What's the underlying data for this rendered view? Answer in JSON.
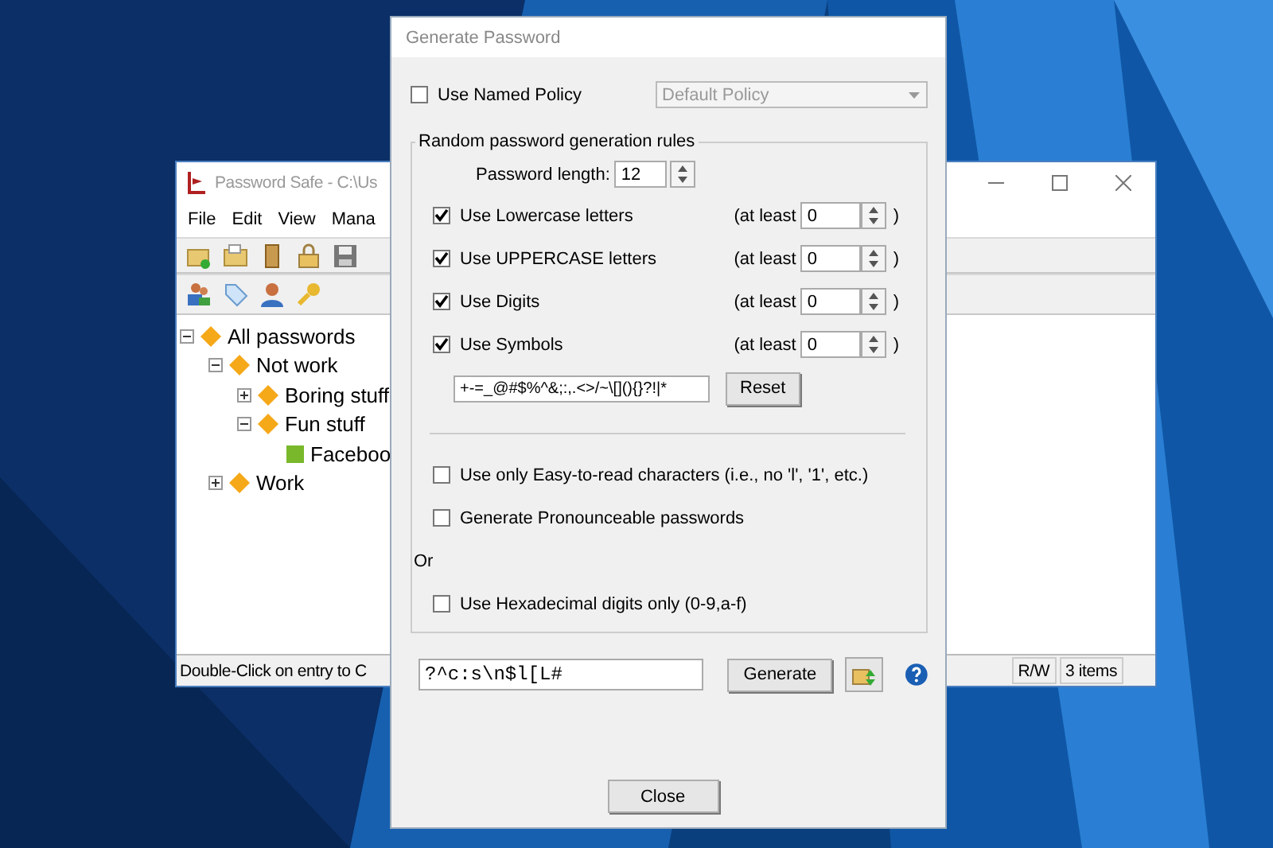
{
  "main_window": {
    "title": "Password Safe - C:\\Us",
    "menu": [
      "File",
      "Edit",
      "View",
      "Mana"
    ],
    "tree": [
      {
        "label": "All passwords",
        "kind": "group",
        "expanded": true,
        "children": [
          {
            "label": "Not work",
            "kind": "group",
            "expanded": true,
            "children": [
              {
                "label": "Boring stuff",
                "kind": "group",
                "expanded": false
              },
              {
                "label": "Fun stuff",
                "kind": "group",
                "expanded": true,
                "children": [
                  {
                    "label": "Faceboo",
                    "kind": "entry"
                  }
                ]
              }
            ]
          },
          {
            "label": "Work",
            "kind": "group",
            "expanded": false
          }
        ]
      }
    ],
    "status_bar": {
      "message": "Double-Click on entry to C",
      "mode": "R/W",
      "count": "3 items"
    }
  },
  "dialog": {
    "title": "Generate Password",
    "named_policy": {
      "label": "Use Named Policy",
      "checked": false,
      "dropdown": {
        "value": "Default Policy",
        "disabled": true
      }
    },
    "rules": {
      "title": "Random password generation rules",
      "length_label": "Password length:",
      "length": "12",
      "char_sets": [
        {
          "label": "Use Lowercase letters",
          "checked": true,
          "at_least": "(at least",
          "count": "0",
          "close": ")"
        },
        {
          "label": "Use UPPERCASE letters",
          "checked": true,
          "at_least": "(at least",
          "count": "0",
          "close": ")"
        },
        {
          "label": "Use Digits",
          "checked": true,
          "at_least": "(at least",
          "count": "0",
          "close": ")"
        },
        {
          "label": "Use Symbols",
          "checked": true,
          "at_least": "(at least",
          "count": "0",
          "close": ")"
        }
      ],
      "symbols": "+-=_@#$%^&;:,.<>/~\\[](){}?!|*",
      "reset": "Reset",
      "options": [
        {
          "kind": "checkbox",
          "label": "Use only Easy-to-read characters (i.e., no 'l', '1', etc.)",
          "checked": false
        },
        {
          "kind": "checkbox",
          "label": "Generate Pronounceable passwords",
          "checked": false
        },
        {
          "kind": "text",
          "label": "Or"
        },
        {
          "kind": "checkbox",
          "label": "Use Hexadecimal digits only (0-9,a-f)",
          "checked": false
        }
      ]
    },
    "password": "?^c:s\\n$l[L#",
    "generate": "Generate",
    "close": "Close"
  }
}
